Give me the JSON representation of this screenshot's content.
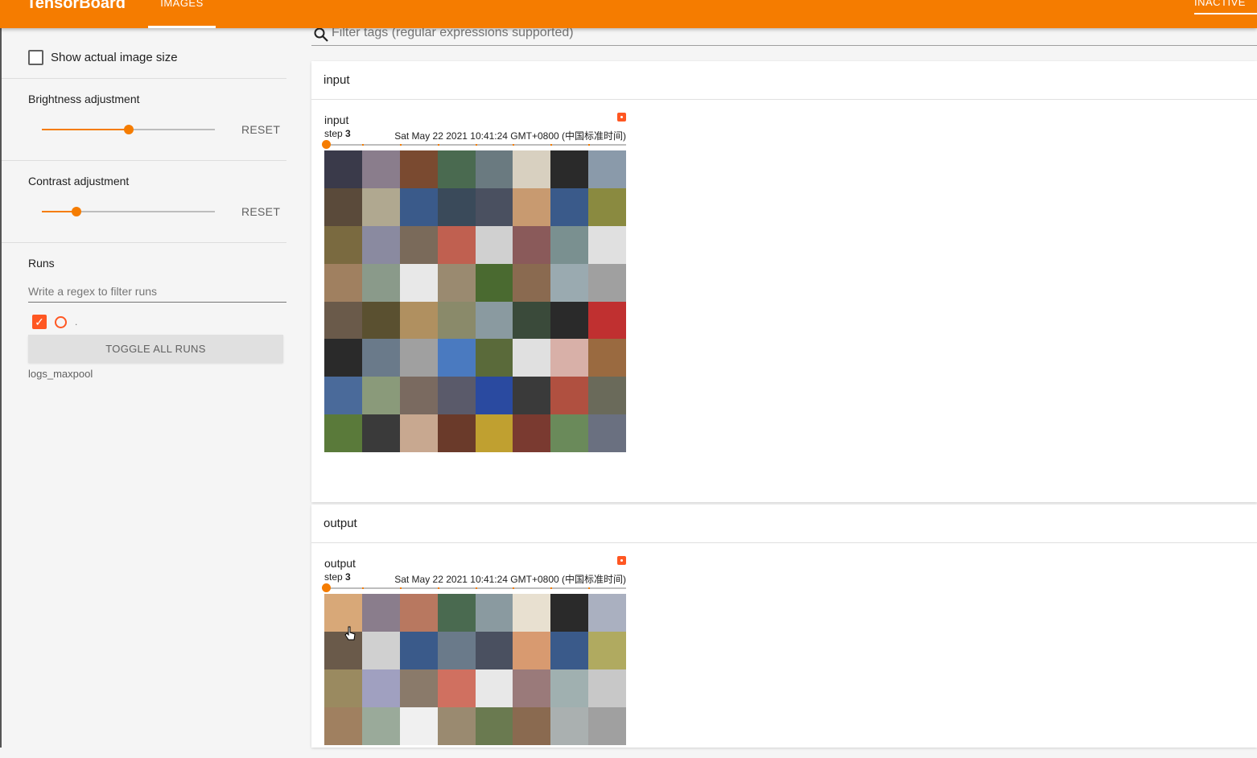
{
  "topbar": {
    "brand": "TensorBoard",
    "tab_images": "IMAGES",
    "status": "INACTIVE",
    "color": "#f57c00"
  },
  "sidebar": {
    "show_actual_size": "Show actual image size",
    "brightness": {
      "label": "Brightness adjustment",
      "reset": "RESET",
      "value": 0.5
    },
    "contrast": {
      "label": "Contrast adjustment",
      "reset": "RESET",
      "value": 0.2
    },
    "runs": {
      "heading": "Runs",
      "filter_placeholder": "Write a regex to filter runs",
      "run_dot": ".",
      "toggle_all": "TOGGLE ALL RUNS",
      "run_name": "logs_maxpool"
    }
  },
  "filter": {
    "placeholder": "Filter tags (regular expressions supported)"
  },
  "cards": [
    {
      "title": "input",
      "pane": {
        "tag": "input",
        "step_label": "step",
        "step": "3",
        "time": "Sat May 22 2021 10:41:24 GMT+0800 (中国标准时间)"
      }
    },
    {
      "title": "output",
      "pane": {
        "tag": "output",
        "step_label": "step",
        "step": "3",
        "time": "Sat May 22 2021 10:41:24 GMT+0800 (中国标准时间)"
      }
    }
  ],
  "grid_colors": [
    "#3a3a4a",
    "#8a7d8c",
    "#7a4a30",
    "#4a6a50",
    "#6a7a80",
    "#d8d0c0",
    "#2a2a2a",
    "#8a9aaa",
    "#5a4a3a",
    "#b0a890",
    "#3a5a8a",
    "#3a4a5a",
    "#4a5060",
    "#c89a70",
    "#3a5a8a",
    "#8a8a40",
    "#7a6a40",
    "#8a8aa0",
    "#7a6a5a",
    "#c06050",
    "#d0d0d0",
    "#8a5a5a",
    "#7a9090",
    "#e0e0e0",
    "#a08060",
    "#8a9a8a",
    "#e8e8e8",
    "#9a8a70",
    "#4a6a30",
    "#8a6a50",
    "#9aaab0",
    "#a0a0a0",
    "#6a5a4a",
    "#5a5030",
    "#b09060",
    "#8a8a6a",
    "#8a9aa0",
    "#3a4a3a",
    "#2a2a2a",
    "#c03030",
    "#2a2a2a",
    "#6a7a8a",
    "#a0a0a0",
    "#4a7ac0",
    "#5a6a3a",
    "#e0e0e0",
    "#d8b0a8",
    "#9a6a40",
    "#4a6a9a",
    "#8a9a7a",
    "#7a6a60",
    "#5a5a6a",
    "#2a4aa0",
    "#3a3a3a",
    "#b05040",
    "#6a6a5a",
    "#5a7a3a",
    "#3a3a3a",
    "#c8a890",
    "#6a3a2a",
    "#c0a030",
    "#7a3a30",
    "#6a8a5a",
    "#6a7080"
  ],
  "output_grid_colors": [
    "#d8a878",
    "#8a7d8c",
    "#b87860",
    "#4a6a50",
    "#8a9aa0",
    "#e8e0d0",
    "#2a2a2a",
    "#aab0c0",
    "#6a5a4a",
    "#d0d0d0",
    "#3a5a8a",
    "#6a7a8a",
    "#4a5060",
    "#d89a70",
    "#3a5a8a",
    "#b0aa60",
    "#9a8a60",
    "#a0a0c0",
    "#8a7a6a",
    "#d07060",
    "#e8e8e8",
    "#9a7a7a",
    "#a0b0b0",
    "#c8c8c8",
    "#a08060",
    "#9aaa9a",
    "#f0f0f0",
    "#9a8a70",
    "#6a7a50",
    "#8a6a50",
    "#aab0b0",
    "#a0a0a0"
  ]
}
